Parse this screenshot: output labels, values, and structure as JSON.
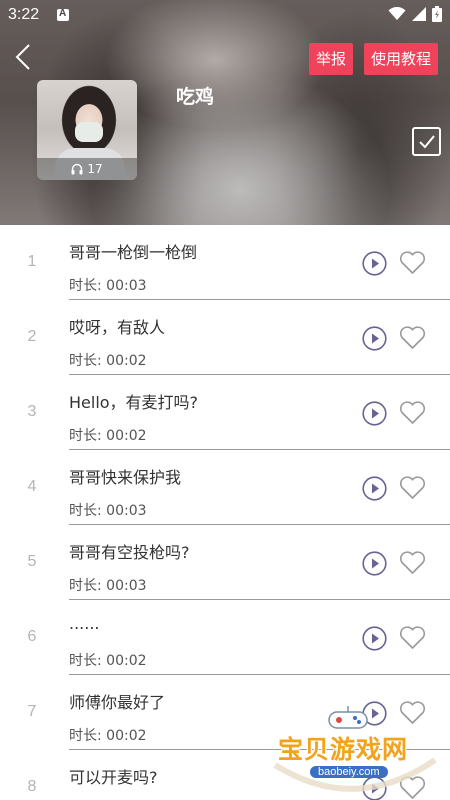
{
  "status_bar": {
    "time": "3:22"
  },
  "header": {
    "title": "吃鸡",
    "report_label": "举报",
    "tutorial_label": "使用教程",
    "listen_count": "17"
  },
  "items": [
    {
      "index": "1",
      "title": "哥哥一枪倒一枪倒",
      "duration": "时长: 00:03"
    },
    {
      "index": "2",
      "title": "哎呀，有敌人",
      "duration": "时长: 00:02"
    },
    {
      "index": "3",
      "title": "Hello，有麦打吗?",
      "duration": "时长: 00:02"
    },
    {
      "index": "4",
      "title": "哥哥快来保护我",
      "duration": "时长: 00:03"
    },
    {
      "index": "5",
      "title": "哥哥有空投枪吗?",
      "duration": "时长: 00:03"
    },
    {
      "index": "6",
      "title": "......",
      "duration": "时长: 00:02"
    },
    {
      "index": "7",
      "title": "师傅你最好了",
      "duration": "时长: 00:02"
    },
    {
      "index": "8",
      "title": "可以开麦吗?",
      "duration": ""
    }
  ],
  "watermark": {
    "text": "宝贝游戏网",
    "url": "baobeiy.com"
  },
  "colors": {
    "accent": "#f0435b",
    "icon_stroke": "#6a6294",
    "heart": "#9a9a9a"
  }
}
